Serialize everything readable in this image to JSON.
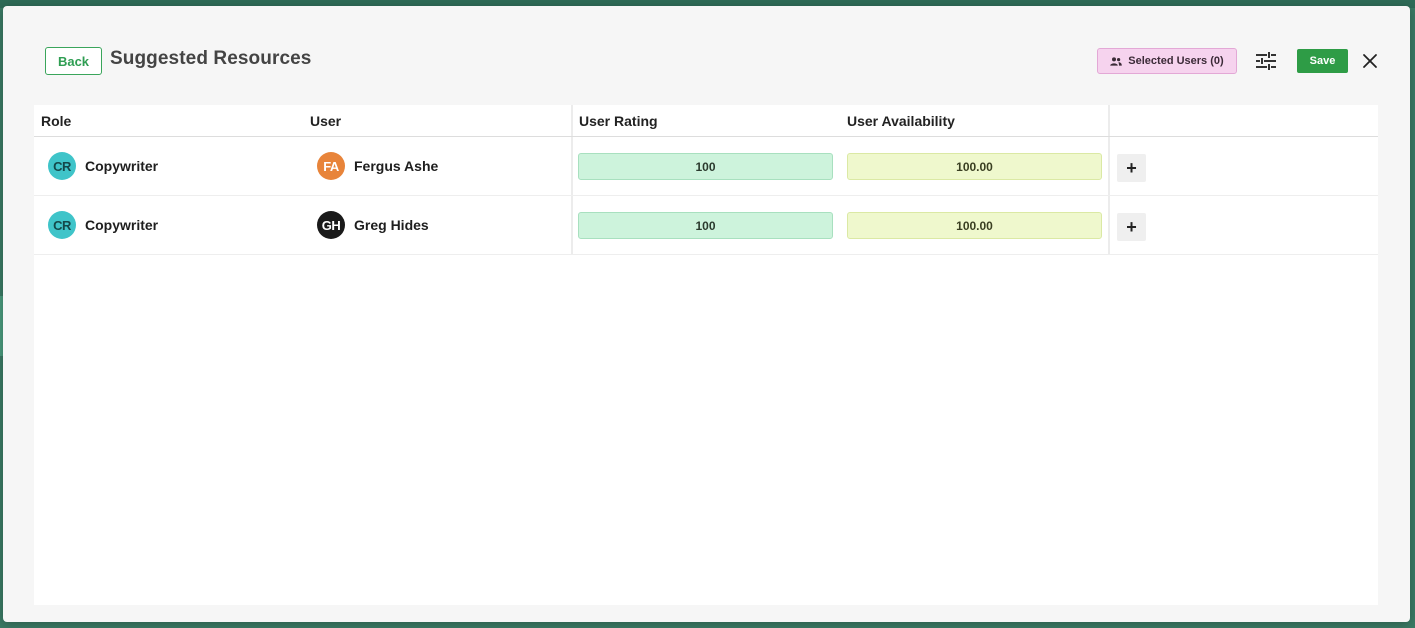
{
  "header": {
    "back_label": "Back",
    "title": "Suggested Resources",
    "selected_users_label": "Selected Users (0)",
    "save_label": "Save"
  },
  "grid": {
    "columns": [
      "Role",
      "User",
      "User Rating",
      "User Availability"
    ],
    "rows": [
      {
        "role_initials": "CR",
        "role": "Copywriter",
        "user_initials": "FA",
        "user": "Fergus Ashe",
        "rating": "100",
        "availability": "100.00",
        "add_label": "+"
      },
      {
        "role_initials": "CR",
        "role": "Copywriter",
        "user_initials": "GH",
        "user": "Greg Hides",
        "rating": "100",
        "availability": "100.00",
        "add_label": "+"
      }
    ]
  },
  "colors": {
    "role_avatar": "#3fc4c9",
    "user_avatar_fa": "#e8843a",
    "user_avatar_gh": "#1a1a1a",
    "save": "#2e9c46",
    "rating_fill": "#cdf3dc",
    "availability_fill": "#eff8cd",
    "selected_users_fill": "#f6d3ee"
  }
}
